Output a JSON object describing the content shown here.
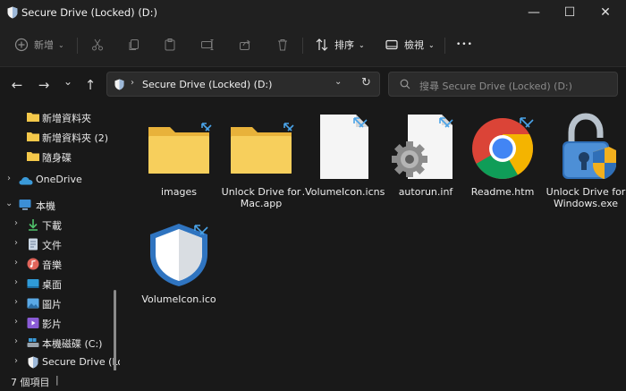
{
  "window": {
    "title": "Secure Drive (Locked) (D:)",
    "minimize_glyph": "—",
    "maximize_glyph": "☐",
    "close_glyph": "✕"
  },
  "toolbar": {
    "new_label": "新增",
    "sort_label": "排序",
    "view_label": "檢視",
    "more_glyph": "•••",
    "icons": [
      "new-icon",
      "cut-icon",
      "copy-icon",
      "paste-icon",
      "rename-icon",
      "share-icon",
      "delete-icon",
      "sort-icon",
      "view-icon",
      "more-icon"
    ]
  },
  "nav": {
    "back_glyph": "←",
    "forward_glyph": "→",
    "recent_glyph": "⌄",
    "up_glyph": "↑"
  },
  "address": {
    "separator": "›",
    "path": "Secure Drive (Locked) (D:)",
    "dropdown_glyph": "⌄",
    "refresh_glyph": "↻"
  },
  "search": {
    "placeholder": "搜尋 Secure Drive (Locked) (D:)"
  },
  "sidebar": {
    "items": [
      {
        "label": "新增資料夾",
        "icon": "folder-icon"
      },
      {
        "label": "新增資料夾 (2)",
        "icon": "folder-icon"
      },
      {
        "label": "隨身碟",
        "icon": "folder-icon"
      },
      {
        "label": "OneDrive",
        "icon": "onedrive-icon"
      },
      {
        "label": "本機",
        "icon": "pc-icon"
      },
      {
        "label": "下載",
        "icon": "download-icon"
      },
      {
        "label": "文件",
        "icon": "documents-icon"
      },
      {
        "label": "音樂",
        "icon": "music-icon"
      },
      {
        "label": "桌面",
        "icon": "desktop-icon"
      },
      {
        "label": "圖片",
        "icon": "pictures-icon"
      },
      {
        "label": "影片",
        "icon": "videos-icon"
      },
      {
        "label": "本機磁碟 (C:)",
        "icon": "drive-icon"
      },
      {
        "label": "Secure Drive (Lo",
        "icon": "shield-icon"
      }
    ]
  },
  "files": [
    {
      "name": "images",
      "icon": "folder-icon"
    },
    {
      "name": "Unlock Drive for Mac.app",
      "icon": "folder-icon"
    },
    {
      "name": ".VolumeIcon.icns",
      "icon": "blank-file-icon"
    },
    {
      "name": "autorun.inf",
      "icon": "settings-file-icon"
    },
    {
      "name": "Readme.htm",
      "icon": "chrome-icon"
    },
    {
      "name": "Unlock Drive for Windows.exe",
      "icon": "padlock-icon"
    },
    {
      "name": "VolumeIcon.ico",
      "icon": "shield-icon"
    }
  ],
  "status": {
    "count": "7 個項目",
    "separator": "|"
  },
  "colors": {
    "background": "#191919",
    "chrome": "#202020",
    "folder": "#f4c84a",
    "accent": "#3a9ad9"
  }
}
